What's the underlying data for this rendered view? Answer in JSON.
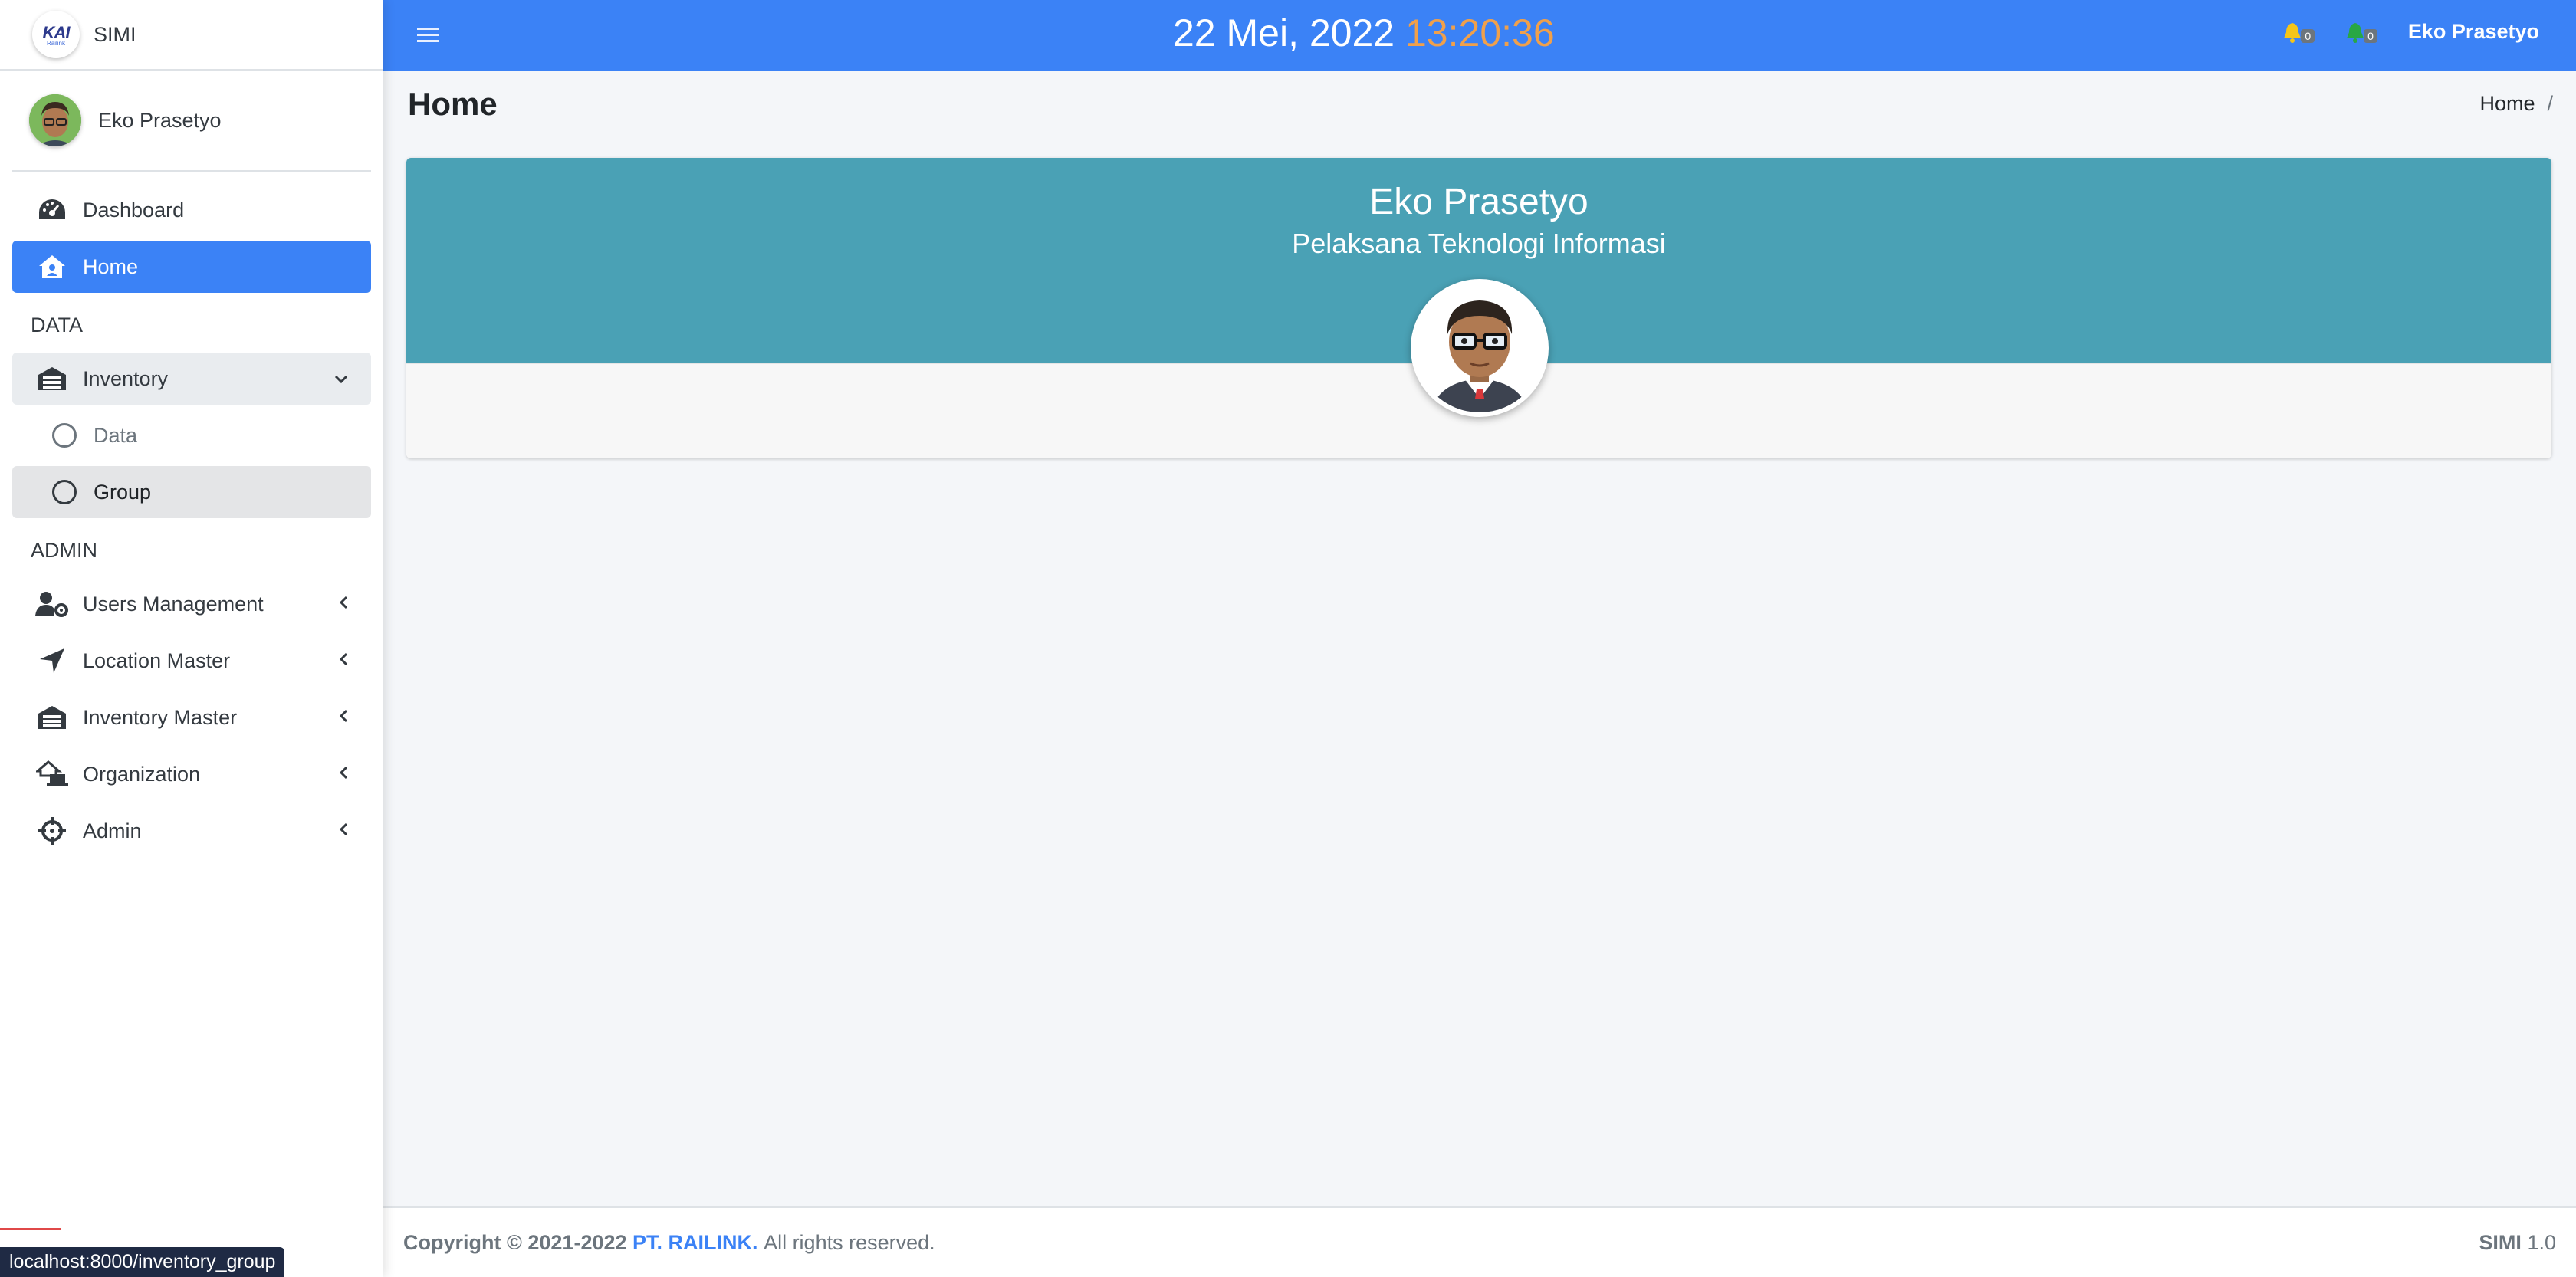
{
  "brand": {
    "logo_text": "KAI",
    "logo_sub": "Railink",
    "name": "SIMI"
  },
  "user": {
    "name": "Eko Prasetyo"
  },
  "sidebar": {
    "dashboard": "Dashboard",
    "home": "Home",
    "header_data": "DATA",
    "inventory": "Inventory",
    "inventory_children": [
      "Data",
      "Group"
    ],
    "header_admin": "ADMIN",
    "admin_items": [
      "Users Management",
      "Location Master",
      "Inventory Master",
      "Organization",
      "Admin"
    ]
  },
  "navbar": {
    "date": "22 Mei, 2022",
    "time": "13:20:36",
    "notif_count_1": "0",
    "notif_count_2": "0",
    "user": "Eko Prasetyo"
  },
  "page": {
    "title": "Home",
    "breadcrumb": "Home",
    "breadcrumb_sep": "/"
  },
  "profile_card": {
    "name": "Eko Prasetyo",
    "role": "Pelaksana Teknologi Informasi"
  },
  "footer": {
    "copyright": "Copyright © 2021-2022",
    "company": "PT. RAILINK.",
    "rights": "All rights reserved.",
    "app": "SIMI",
    "version": "1.0"
  },
  "status_url": "localhost:8000/inventory_group",
  "colors": {
    "primary": "#3b82f6",
    "card_header": "#4aa1b5",
    "clock_time": "#f0a04b"
  }
}
